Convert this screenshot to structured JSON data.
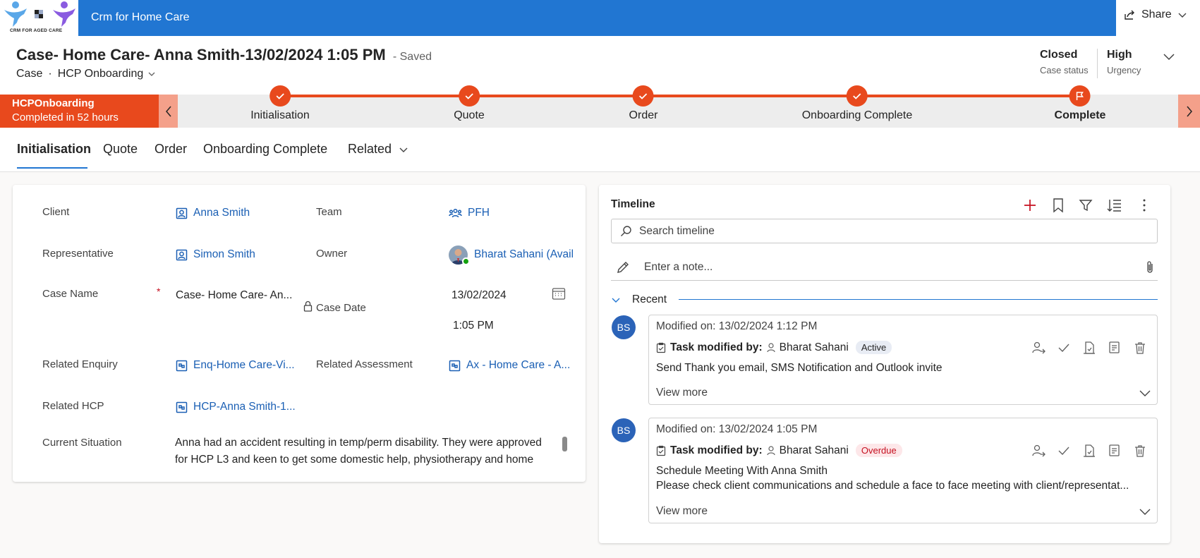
{
  "brand": {
    "logo_text": "CRM FOR AGED CARE"
  },
  "app": {
    "title": "Crm for Home Care",
    "share_label": "Share"
  },
  "header": {
    "title": "Case- Home Care- Anna Smith-13/02/2024 1:05 PM",
    "saved_status": "- Saved",
    "entity": "Case",
    "separator": "·",
    "form_name": "HCP Onboarding",
    "fields": [
      {
        "value": "Closed",
        "label": "Case status"
      },
      {
        "value": "High",
        "label": "Urgency"
      }
    ]
  },
  "bpf": {
    "active_name": "HCPOnboarding",
    "active_status": "Completed in 52 hours",
    "stages": [
      {
        "label": "Initialisation",
        "state": "done"
      },
      {
        "label": "Quote",
        "state": "done"
      },
      {
        "label": "Order",
        "state": "done"
      },
      {
        "label": "Onboarding Complete",
        "state": "done"
      },
      {
        "label": "Complete",
        "state": "current"
      }
    ]
  },
  "tabs": [
    "Initialisation",
    "Quote",
    "Order",
    "Onboarding Complete",
    "Related"
  ],
  "form": {
    "client_label": "Client",
    "client_value": "Anna Smith",
    "team_label": "Team",
    "team_value": "PFH",
    "representative_label": "Representative",
    "representative_value": "Simon Smith",
    "owner_label": "Owner",
    "owner_value": "Bharat Sahani (Availa",
    "case_name_label": "Case Name",
    "required_mark": "*",
    "case_name_value": "Case- Home Care- An...",
    "case_date_label": "Case Date",
    "case_date_value": "13/02/2024",
    "case_time_value": "1:05 PM",
    "related_enquiry_label": "Related Enquiry",
    "related_enquiry_value": "Enq-Home Care-Vi...",
    "related_assessment_label": "Related Assessment",
    "related_assessment_value": "Ax - Home Care - A...",
    "related_hcp_label": "Related HCP",
    "related_hcp_value": "HCP-Anna Smith-1...",
    "current_situation_label": "Current Situation",
    "current_situation_value": "Anna had an accident resulting in temp/perm disability. They were approved for HCP L3 and keen to get some domestic help, physiotherapy and home"
  },
  "timeline": {
    "title": "Timeline",
    "search_placeholder": "Search timeline",
    "note_placeholder": "Enter a note...",
    "section_label": "Recent",
    "entries": [
      {
        "initials": "BS",
        "modified": "Modified on: 13/02/2024 1:12 PM",
        "task_prefix": "Task modified by:",
        "author": "Bharat Sahani",
        "badge": "Active",
        "line1": "Send Thank you email, SMS Notification and Outlook invite",
        "line2": "",
        "view_more": "View more"
      },
      {
        "initials": "BS",
        "modified": "Modified on: 13/02/2024 1:05 PM",
        "task_prefix": "Task modified by:",
        "author": "Bharat Sahani",
        "badge": "Overdue",
        "line1": "Schedule Meeting With Anna Smith",
        "line2": "Please check client communications and schedule a face to face meeting with client/representat...",
        "view_more": "View more"
      }
    ]
  },
  "colors": {
    "accent": "#2176d2",
    "bpf": "#e8491d",
    "link": "#1a5fb4"
  }
}
